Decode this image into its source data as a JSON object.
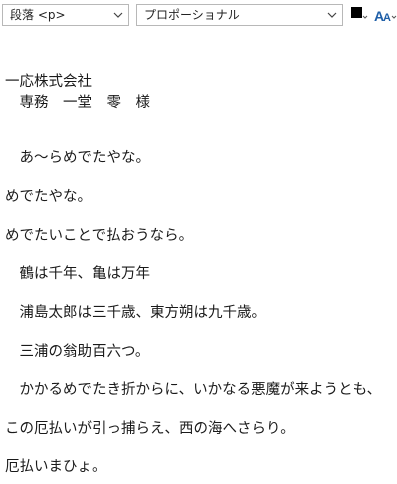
{
  "toolbar": {
    "format_select": {
      "value": "段落 <p>"
    },
    "font_select": {
      "value": "プロポーショナル"
    },
    "text_color": {
      "icon": "text-color-icon",
      "color": "#000000"
    },
    "font_size": {
      "icon": "font-size-icon",
      "color": "#1f5fa8"
    }
  },
  "document": {
    "lines": [
      "一応株式会社",
      "　専務　一堂　零　様",
      "　あ～らめでたやな。",
      "めでたやな。",
      "めでたいことで払おうなら。",
      "　鶴は千年、亀は万年",
      "　浦島太郎は三千歳、東方朔は九千歳。",
      "　三浦の翁助百六つ。",
      "　かかるめでたき折からに、いかなる悪魔が来ようとも、",
      "この厄払いが引っ捕らえ、西の海へさらり。",
      "厄払いまひょ。"
    ]
  }
}
